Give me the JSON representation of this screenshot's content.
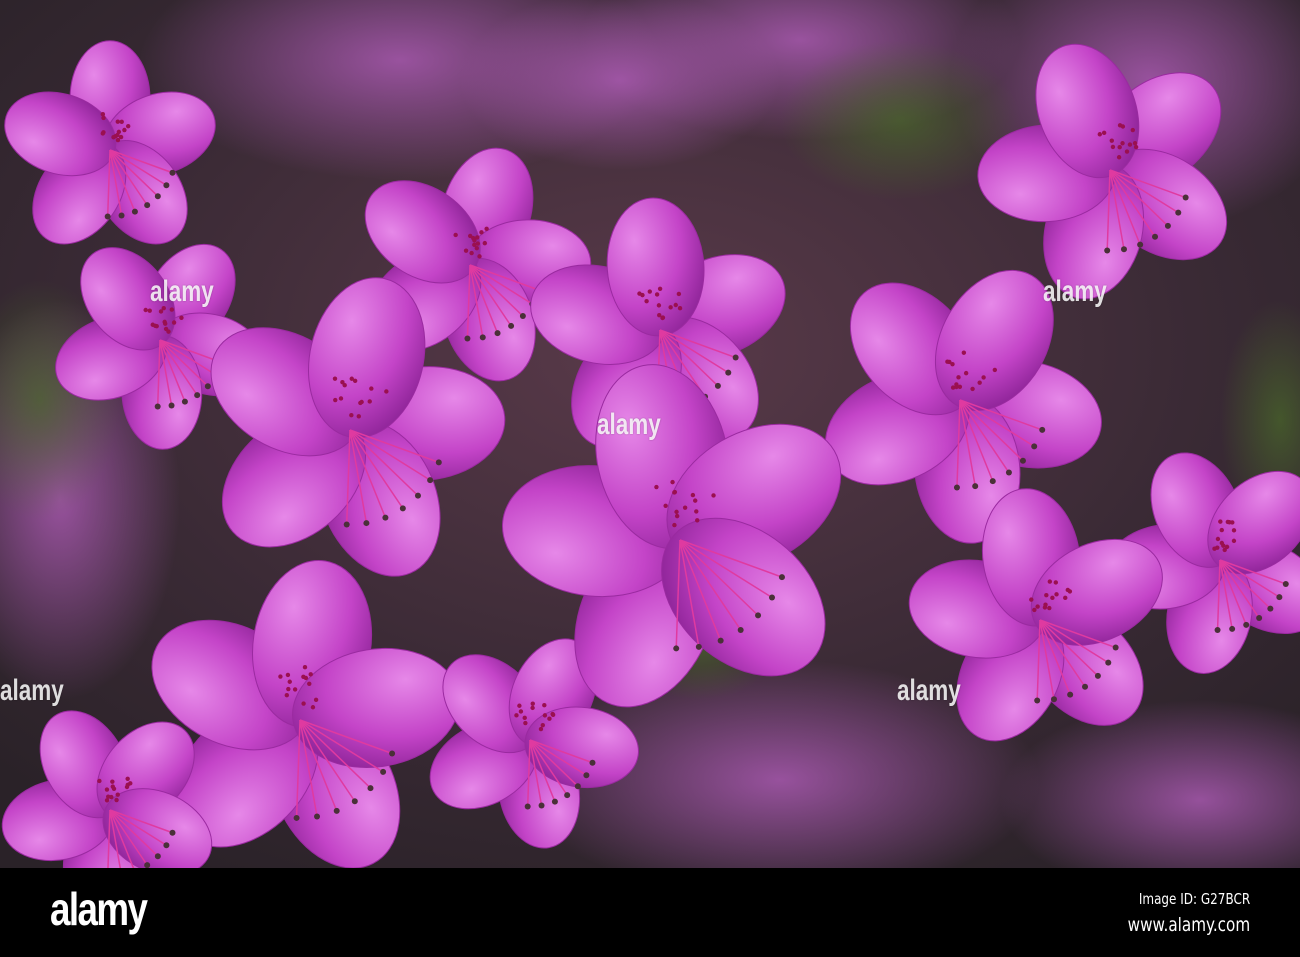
{
  "watermark": {
    "brand": "alamy",
    "overlay_text": "alamy"
  },
  "footer": {
    "logo": "alamy",
    "image_id": "Image ID: G27BCR",
    "website": "www.alamy.com"
  },
  "colors": {
    "petal": "#c43fc8",
    "petal_light": "#e07ae0",
    "throat": "#a0105a",
    "foliage": "#2a3a1c",
    "background": "#000000"
  }
}
